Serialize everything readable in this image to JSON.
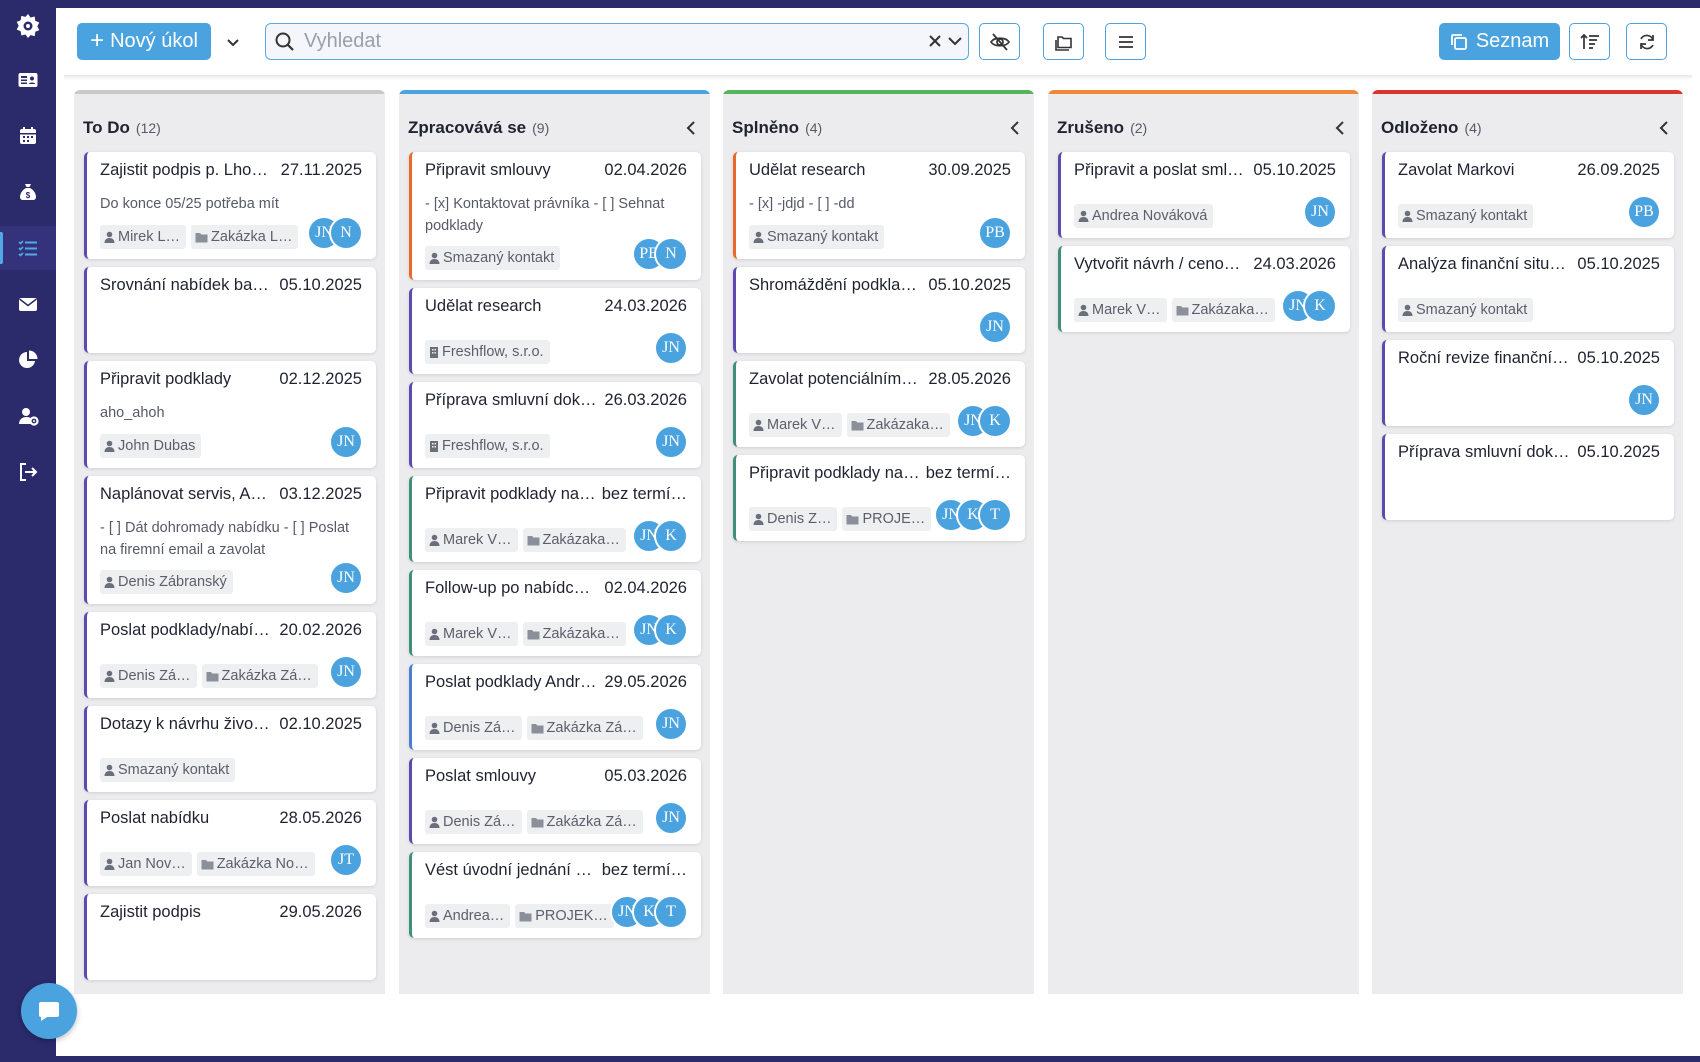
{
  "colors": {
    "sidebar_bg": "#2b2a6b",
    "accent": "#4aa3df",
    "column_bg": "#ececee",
    "todo_bar": "#c9c9cc",
    "in_progress_bar": "#4aa3df",
    "done_bar": "#58b45c",
    "canceled_bar": "#f0883a",
    "postponed_bar": "#d9352b",
    "card_purple": "#5d4ab0",
    "card_orange": "#e8692c",
    "card_teal": "#3f8f7b",
    "card_blue": "#4a7fd0"
  },
  "sidebar": {
    "logo_icon": "gear-logo-icon",
    "items": [
      {
        "icon": "contact-card-icon",
        "active": false
      },
      {
        "icon": "calendar-icon",
        "active": false
      },
      {
        "icon": "money-bag-icon",
        "active": false
      },
      {
        "icon": "task-list-icon",
        "active": true
      },
      {
        "icon": "mail-icon",
        "active": false
      },
      {
        "icon": "pie-chart-icon",
        "active": false
      },
      {
        "icon": "user-settings-icon",
        "active": false
      },
      {
        "icon": "logout-icon",
        "active": false
      }
    ]
  },
  "toolbar": {
    "new_task_label": "Nový úkol",
    "search_placeholder": "Vyhledat",
    "search_value": "",
    "list_view_label": "Seznam"
  },
  "columns": [
    {
      "title": "To Do",
      "count": "(12)",
      "bar_color": "#c9c9cc",
      "cards": [
        {
          "title": "Zajistit podpis p. Lhotecké",
          "date": "27.11.2025",
          "desc": "Do konce 05/25 potřeba mít",
          "tags": [
            {
              "type": "person",
              "label": "Mirek L…"
            },
            {
              "type": "folder",
              "label": "Zakázka L…"
            }
          ],
          "avatars": [
            "JN",
            "N"
          ],
          "accent": "#5d4ab0"
        },
        {
          "title": "Srovnání nabídek bank a pojišťoven",
          "date": "05.10.2025",
          "desc": "",
          "tags": [],
          "avatars": [],
          "accent": "#5d4ab0"
        },
        {
          "title": "Připravit podklady",
          "date": "02.12.2025",
          "desc": "aho_ahoh",
          "tags": [
            {
              "type": "person",
              "label": "John Dubas"
            }
          ],
          "avatars": [
            "JN"
          ],
          "accent": "#5d4ab0"
        },
        {
          "title": "Naplánovat servis, Andrea",
          "date": "03.12.2025",
          "desc": "- [ ] Dát dohromady nabídku - [ ] Poslat na firemní email a zavolat",
          "tags": [
            {
              "type": "person",
              "label": "Denis Zábranský"
            }
          ],
          "avatars": [
            "JN"
          ],
          "accent": "#5d4ab0"
        },
        {
          "title": "Poslat podklady/nabídku",
          "date": "20.02.2026",
          "desc": "",
          "tags": [
            {
              "type": "person",
              "label": "Denis Zá…"
            },
            {
              "type": "folder",
              "label": "Zakázka Zá…"
            }
          ],
          "avatars": [
            "JN"
          ],
          "accent": "#5d4ab0"
        },
        {
          "title": "Dotazy k návrhu životního pojištění",
          "date": "02.10.2025",
          "desc": "",
          "tags": [
            {
              "type": "person",
              "label": "Smazaný kontakt"
            }
          ],
          "avatars": [],
          "accent": "#5d4ab0"
        },
        {
          "title": "Poslat nabídku",
          "date": "28.05.2026",
          "desc": "",
          "tags": [
            {
              "type": "person",
              "label": "Jan Nov…"
            },
            {
              "type": "folder",
              "label": "Zakázka No…"
            }
          ],
          "avatars": [
            "JT"
          ],
          "accent": "#5d4ab0"
        },
        {
          "title": "Zajistit podpis",
          "date": "29.05.2026",
          "desc": "",
          "tags": [],
          "avatars": [],
          "accent": "#5d4ab0"
        }
      ]
    },
    {
      "title": "Zpracovává se",
      "count": "(9)",
      "bar_color": "#4aa3df",
      "cards": [
        {
          "title": "Připravit smlouvy",
          "date": "02.04.2026",
          "desc": "- [x] Kontaktovat právníka - [ ] Sehnat podklady",
          "tags": [
            {
              "type": "person",
              "label": "Smazaný kontakt"
            }
          ],
          "avatars": [
            "PB",
            "N"
          ],
          "accent": "#e8692c"
        },
        {
          "title": "Udělat research",
          "date": "24.03.2026",
          "desc": "",
          "tags": [
            {
              "type": "company",
              "label": "Freshflow, s.r.o."
            }
          ],
          "avatars": [
            "JN"
          ],
          "accent": "#5d4ab0"
        },
        {
          "title": "Příprava smluvní dokumentace",
          "date": "26.03.2026",
          "desc": "",
          "tags": [
            {
              "type": "company",
              "label": "Freshflow, s.r.o."
            }
          ],
          "avatars": [
            "JN"
          ],
          "accent": "#5d4ab0"
        },
        {
          "title": "Připravit podklady na schůzku",
          "date": "bez termí…",
          "desc": "",
          "tags": [
            {
              "type": "person",
              "label": "Marek V…"
            },
            {
              "type": "folder",
              "label": "Zakázaka…"
            }
          ],
          "avatars": [
            "JN",
            "K"
          ],
          "accent": "#3f8f7b"
        },
        {
          "title": "Follow-up po nabídce (email)",
          "date": "02.04.2026",
          "desc": "",
          "tags": [
            {
              "type": "person",
              "label": "Marek V…"
            },
            {
              "type": "folder",
              "label": "Zakázaka…"
            }
          ],
          "avatars": [
            "JN",
            "K"
          ],
          "accent": "#3f8f7b"
        },
        {
          "title": "Poslat podklady Andrejovi",
          "date": "29.05.2026",
          "desc": "",
          "tags": [
            {
              "type": "person",
              "label": "Denis Zá…"
            },
            {
              "type": "folder",
              "label": "Zakázka Zá…"
            }
          ],
          "avatars": [
            "JN"
          ],
          "accent": "#4a7fd0"
        },
        {
          "title": "Poslat smlouvy",
          "date": "05.03.2026",
          "desc": "",
          "tags": [
            {
              "type": "person",
              "label": "Denis Zá…"
            },
            {
              "type": "folder",
              "label": "Zakázka Zá…"
            }
          ],
          "avatars": [
            "JN"
          ],
          "accent": "#5d4ab0"
        },
        {
          "title": "Vést úvodní jednání s klientem",
          "date": "bez termí…",
          "desc": "",
          "tags": [
            {
              "type": "person",
              "label": "Andrea…"
            },
            {
              "type": "folder",
              "label": "PROJEK…"
            }
          ],
          "avatars": [
            "JN",
            "K",
            "T"
          ],
          "accent": "#3f8f7b"
        }
      ]
    },
    {
      "title": "Splněno",
      "count": "(4)",
      "bar_color": "#58b45c",
      "cards": [
        {
          "title": "Udělat research",
          "date": "30.09.2025",
          "desc": "- [x] -jdjd - [ ] -dd",
          "tags": [
            {
              "type": "person",
              "label": "Smazaný kontakt"
            }
          ],
          "avatars": [
            "PB"
          ],
          "accent": "#e8692c"
        },
        {
          "title": "Shromáždění podkladů od klienta",
          "date": "05.10.2025",
          "desc": "",
          "tags": [],
          "avatars": [
            "JN"
          ],
          "accent": "#5d4ab0"
        },
        {
          "title": "Zavolat potenciálnímu klientovi",
          "date": "28.05.2026",
          "desc": "",
          "tags": [
            {
              "type": "person",
              "label": "Marek V…"
            },
            {
              "type": "folder",
              "label": "Zakázaka…"
            }
          ],
          "avatars": [
            "JN",
            "K"
          ],
          "accent": "#3f8f7b"
        },
        {
          "title": "Připravit podklady na schůzku",
          "date": "bez termí…",
          "desc": "",
          "tags": [
            {
              "type": "person",
              "label": "Denis Z…"
            },
            {
              "type": "folder",
              "label": "PROJE…"
            }
          ],
          "avatars": [
            "JN",
            "K",
            "T"
          ],
          "accent": "#3f8f7b"
        }
      ]
    },
    {
      "title": "Zrušeno",
      "count": "(2)",
      "bar_color": "#f0883a",
      "cards": [
        {
          "title": "Připravit a poslat smlouvu",
          "date": "05.10.2025",
          "desc": "",
          "tags": [
            {
              "type": "person",
              "label": "Andrea Nováková"
            }
          ],
          "avatars": [
            "JN"
          ],
          "accent": "#5d4ab0"
        },
        {
          "title": "Vytvořit návrh / cenovou nabídku",
          "date": "24.03.2026",
          "desc": "",
          "tags": [
            {
              "type": "person",
              "label": "Marek V…"
            },
            {
              "type": "folder",
              "label": "Zakázaka…"
            }
          ],
          "avatars": [
            "JN",
            "K"
          ],
          "accent": "#3f8f7b"
        }
      ]
    },
    {
      "title": "Odloženo",
      "count": "(4)",
      "bar_color": "#d9352b",
      "cards": [
        {
          "title": "Zavolat Markovi",
          "date": "26.09.2025",
          "desc": "",
          "tags": [
            {
              "type": "person",
              "label": "Smazaný kontakt"
            }
          ],
          "avatars": [
            "PB"
          ],
          "accent": "#5d4ab0"
        },
        {
          "title": "Analýza finanční situace klienta",
          "date": "05.10.2025",
          "desc": "",
          "tags": [
            {
              "type": "person",
              "label": "Smazaný kontakt"
            }
          ],
          "avatars": [],
          "accent": "#5d4ab0"
        },
        {
          "title": "Roční revize finančního plánu",
          "date": "05.10.2025",
          "desc": "",
          "tags": [],
          "avatars": [
            "JN"
          ],
          "accent": "#5d4ab0"
        },
        {
          "title": "Příprava smluvní dokumentace",
          "date": "05.10.2025",
          "desc": "",
          "tags": [],
          "avatars": [],
          "accent": "#5d4ab0"
        }
      ]
    }
  ]
}
